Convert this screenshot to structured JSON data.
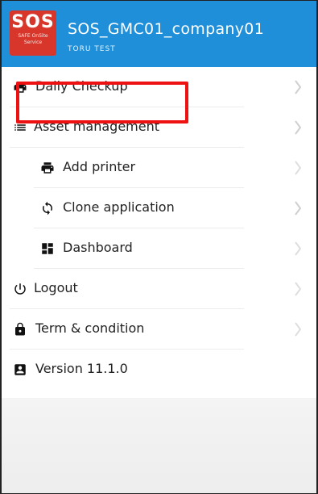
{
  "header": {
    "logo_text": "SOS",
    "logo_subtext": "SAFE OnSite\nService",
    "company_name": "SOS_GMC01_company01",
    "user_name": "TORU TEST",
    "background_color": "#1e8fd8",
    "logo_color": "#d9362b"
  },
  "menu": {
    "items": [
      {
        "label": "Daily Checkup",
        "icon": "printer-icon"
      },
      {
        "label": "Asset management",
        "icon": "list-icon"
      },
      {
        "label": "Add printer",
        "icon": "printer-icon",
        "highlighted": true
      },
      {
        "label": "Clone application",
        "icon": "sync-icon"
      },
      {
        "label": "Dashboard",
        "icon": "dashboard-icon"
      },
      {
        "label": "Logout",
        "icon": "power-icon"
      },
      {
        "label": "Term & condition",
        "icon": "lock-icon"
      },
      {
        "label": "Version 11.1.0",
        "icon": "account-box-icon"
      }
    ]
  },
  "highlight_color": "#ee1111"
}
